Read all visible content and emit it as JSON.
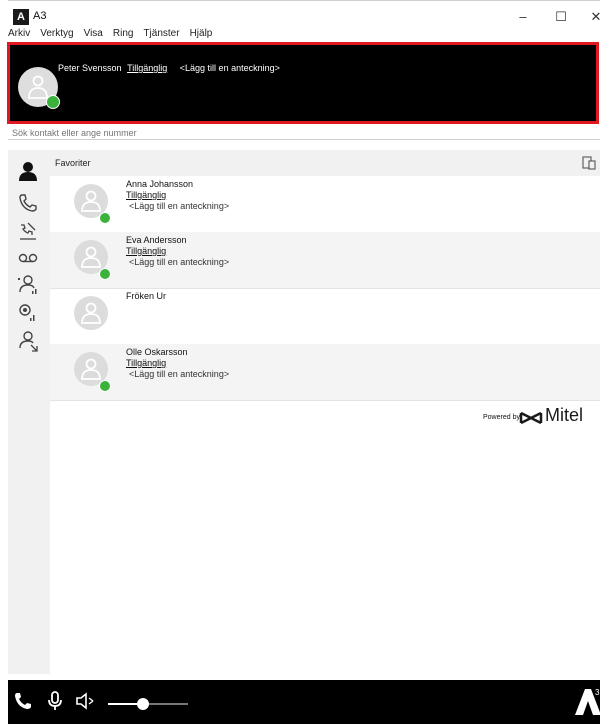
{
  "window": {
    "title": "A3",
    "app_icon_text": "A",
    "minimize": "–",
    "maximize": "☐",
    "close": "✕"
  },
  "menu": [
    "Arkiv",
    "Verktyg",
    "Visa",
    "Ring",
    "Tjänster",
    "Hjälp"
  ],
  "self": {
    "name": "Peter Svensson",
    "status": "Tillgänglig",
    "note": "<Lägg till en anteckning>",
    "status_color": "#3bb33b"
  },
  "search": {
    "placeholder": "Sök kontakt eller ange nummer"
  },
  "rail": [
    "contacts-icon",
    "phone-icon",
    "call-log-icon",
    "voicemail-icon",
    "group-presence-icon",
    "queue-icon",
    "transfer-icon"
  ],
  "favorites": {
    "title": "Favoriter",
    "contacts": [
      {
        "name": "Anna Johansson",
        "status": "Tillgänglig",
        "note": "<Lägg till en anteckning>",
        "online": true
      },
      {
        "name": "Eva Andersson",
        "status": "Tillgänglig",
        "note": "<Lägg till en anteckning>",
        "online": true
      },
      {
        "name": "Fröken Ur",
        "status": "",
        "note": "",
        "online": false
      },
      {
        "name": "Olle Oskarsson",
        "status": "Tillgänglig",
        "note": "<Lägg till en anteckning>",
        "online": true
      }
    ]
  },
  "branding": {
    "powered_by": "Powered by",
    "vendor": "Mitel"
  },
  "colors": {
    "accent_red": "#e01822",
    "available_green": "#3bb33b",
    "bar_black": "#000000"
  },
  "volume": 0.4
}
